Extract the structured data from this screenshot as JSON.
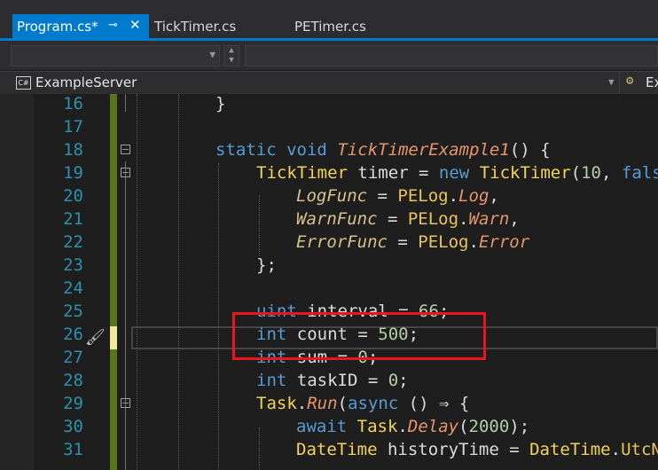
{
  "tabs": [
    {
      "label": "Program.cs*",
      "active": true,
      "pin": "⊸",
      "close": "✕"
    },
    {
      "label": "TickTimer.cs",
      "active": false
    },
    {
      "label": "PETimer.cs",
      "active": false
    }
  ],
  "nav": {
    "project_icon": "C#",
    "project": "ExampleServer",
    "right_partial": "Ex"
  },
  "colors": {
    "accent": "#007acc",
    "line_number": "#2b91af",
    "keyword": "#569cd6",
    "highlight_box": "#e8161d"
  },
  "lines": [
    {
      "n": "16",
      "tokens": [
        [
          "p",
          "}"
        ]
      ]
    },
    {
      "n": "17",
      "tokens": []
    },
    {
      "n": "18",
      "tokens": [
        [
          "kw",
          "static"
        ],
        [
          "p",
          " "
        ],
        [
          "kw",
          "void"
        ],
        [
          "p",
          " "
        ],
        [
          "mt",
          "TickTimerExample1"
        ],
        [
          "p",
          "() {"
        ]
      ]
    },
    {
      "n": "19",
      "tokens": [
        [
          "cl",
          "TickTimer"
        ],
        [
          "p",
          " timer = "
        ],
        [
          "kw",
          "new"
        ],
        [
          "p",
          " "
        ],
        [
          "cl",
          "TickTimer"
        ],
        [
          "p",
          "("
        ],
        [
          "num",
          "10"
        ],
        [
          "p",
          ", "
        ],
        [
          "kw",
          "fals"
        ]
      ]
    },
    {
      "n": "20",
      "tokens": [
        [
          "pr",
          "LogFunc"
        ],
        [
          "p",
          " = "
        ],
        [
          "fn",
          "PELog"
        ],
        [
          "p",
          "."
        ],
        [
          "mt",
          "Log"
        ],
        [
          "p",
          ","
        ]
      ]
    },
    {
      "n": "21",
      "tokens": [
        [
          "pr",
          "WarnFunc"
        ],
        [
          "p",
          " = "
        ],
        [
          "fn",
          "PELog"
        ],
        [
          "p",
          "."
        ],
        [
          "mt",
          "Warn"
        ],
        [
          "p",
          ","
        ]
      ]
    },
    {
      "n": "22",
      "tokens": [
        [
          "pr",
          "ErrorFunc"
        ],
        [
          "p",
          " = "
        ],
        [
          "fn",
          "PELog"
        ],
        [
          "p",
          "."
        ],
        [
          "mt",
          "Error"
        ]
      ]
    },
    {
      "n": "23",
      "tokens": [
        [
          "p",
          "};"
        ]
      ]
    },
    {
      "n": "24",
      "tokens": []
    },
    {
      "n": "25",
      "tokens": [
        [
          "kw",
          "uint"
        ],
        [
          "p",
          " interval = "
        ],
        [
          "num",
          "66"
        ],
        [
          "p",
          ";"
        ]
      ]
    },
    {
      "n": "26",
      "tokens": [
        [
          "kw",
          "int"
        ],
        [
          "p",
          " count = "
        ],
        [
          "num",
          "500"
        ],
        [
          "p",
          ";"
        ]
      ]
    },
    {
      "n": "27",
      "tokens": [
        [
          "kw",
          "int"
        ],
        [
          "p",
          " sum = "
        ],
        [
          "num",
          "0"
        ],
        [
          "p",
          ";"
        ]
      ]
    },
    {
      "n": "28",
      "tokens": [
        [
          "kw",
          "int"
        ],
        [
          "p",
          " taskID = "
        ],
        [
          "num",
          "0"
        ],
        [
          "p",
          ";"
        ]
      ]
    },
    {
      "n": "29",
      "tokens": [
        [
          "cl",
          "Task"
        ],
        [
          "p",
          "."
        ],
        [
          "mt",
          "Run"
        ],
        [
          "p",
          "("
        ],
        [
          "kw",
          "async"
        ],
        [
          "p",
          " () ⇒ {"
        ]
      ]
    },
    {
      "n": "30",
      "tokens": [
        [
          "kw",
          "await"
        ],
        [
          "p",
          " "
        ],
        [
          "cl",
          "Task"
        ],
        [
          "p",
          "."
        ],
        [
          "mt",
          "Delay"
        ],
        [
          "p",
          "("
        ],
        [
          "num",
          "2000"
        ],
        [
          "p",
          ");"
        ]
      ]
    },
    {
      "n": "31",
      "tokens": [
        [
          "cl",
          "DateTime"
        ],
        [
          "p",
          " historyTime = "
        ],
        [
          "cl",
          "DateTime"
        ],
        [
          "p",
          "."
        ],
        [
          "fn",
          "UtcN"
        ]
      ]
    }
  ]
}
